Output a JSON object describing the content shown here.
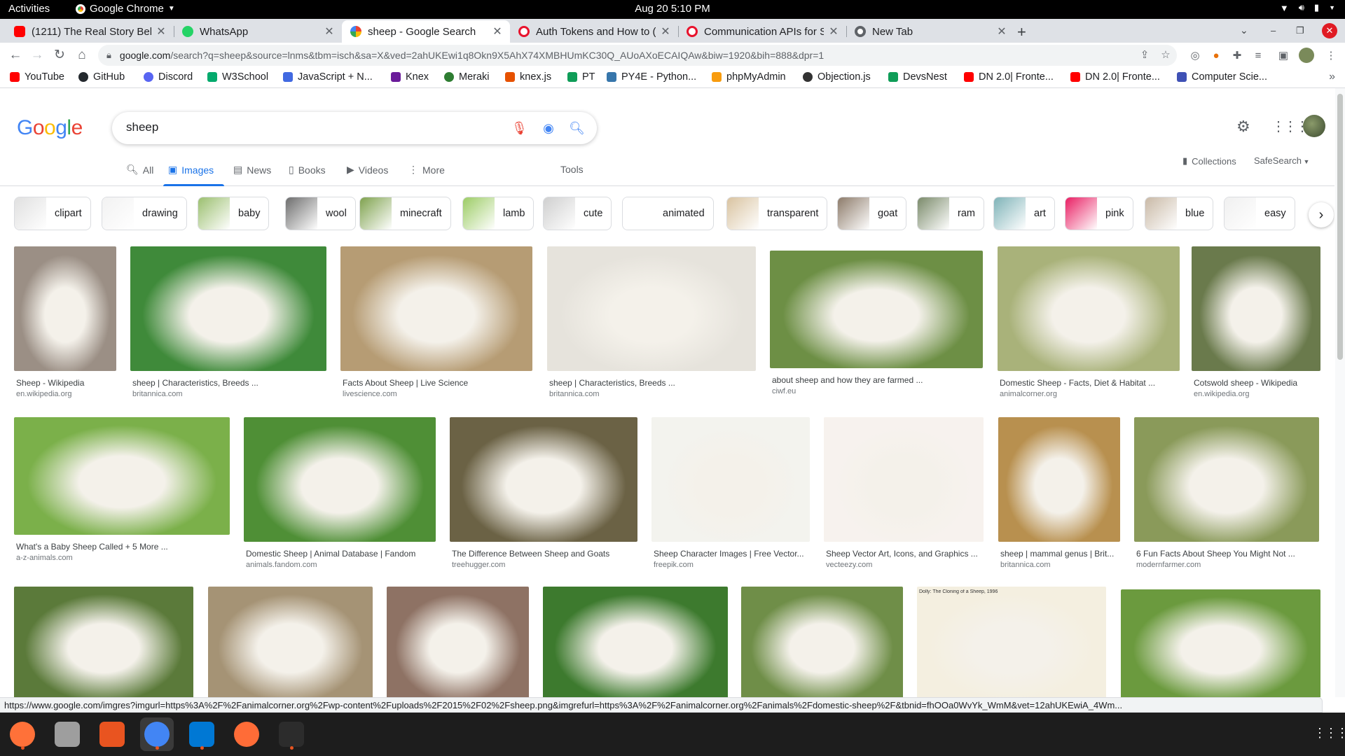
{
  "system": {
    "activities": "Activities",
    "app_name": "Google Chrome",
    "clock": "Aug 20  5:10 PM"
  },
  "tabs": [
    {
      "title": "(1211) The Real Story Behi",
      "favicon_color": "#ff0000",
      "favicon": "youtube-icon"
    },
    {
      "title": "WhatsApp",
      "favicon_color": "#25d366",
      "favicon": "whatsapp-icon"
    },
    {
      "title": "sheep - Google Search",
      "favicon_color": "#4285f4",
      "favicon": "google-icon"
    },
    {
      "title": "Auth Tokens and How to (",
      "favicon_color": "#e8132d",
      "favicon": "twilio-icon"
    },
    {
      "title": "Communication APIs for S",
      "favicon_color": "#e8132d",
      "favicon": "twilio-icon"
    },
    {
      "title": "New Tab",
      "favicon_color": "#5f6368",
      "favicon": "chrome-icon"
    }
  ],
  "toolbar": {
    "url_host": "google.com",
    "url_rest": "/search?q=sheep&source=lnms&tbm=isch&sa=X&ved=2ahUKEwi1q8Okn9X5AhX74XMBHUmKC30Q_AUoAXoECAIQAw&biw=1920&bih=888&dpr=1"
  },
  "bookmarks": [
    {
      "label": "YouTube",
      "color": "#ff0000"
    },
    {
      "label": "GitHub",
      "color": "#24292e"
    },
    {
      "label": "Discord",
      "color": "#5865f2"
    },
    {
      "label": "W3School",
      "color": "#04aa6d"
    },
    {
      "label": "JavaScript + N...",
      "color": "#4169e1"
    },
    {
      "label": "Knex",
      "color": "#6a1b9a"
    },
    {
      "label": "Meraki",
      "color": "#2e7d32"
    },
    {
      "label": "knex.js",
      "color": "#e65100"
    },
    {
      "label": "PT",
      "color": "#0f9d58"
    },
    {
      "label": "PY4E - Python...",
      "color": "#3776ab"
    },
    {
      "label": "phpMyAdmin",
      "color": "#f89c0e"
    },
    {
      "label": "Objection.js",
      "color": "#333333"
    },
    {
      "label": "DevsNest",
      "color": "#0f9d58"
    },
    {
      "label": "DN 2.0| Fronte...",
      "color": "#ff0000"
    },
    {
      "label": "DN 2.0| Fronte...",
      "color": "#ff0000"
    },
    {
      "label": "Computer Scie...",
      "color": "#3f51b5"
    }
  ],
  "search": {
    "query": "sheep"
  },
  "nav": {
    "all": "All",
    "images": "Images",
    "news": "News",
    "books": "Books",
    "videos": "Videos",
    "more": "More",
    "tools": "Tools",
    "collections": "Collections",
    "safesearch": "SafeSearch"
  },
  "chips": [
    {
      "label": "clipart",
      "color": "#e0e0e0"
    },
    {
      "label": "drawing",
      "color": "#f2f2f2"
    },
    {
      "label": "baby",
      "color": "#9bbf6f"
    },
    {
      "label": "wool",
      "color": "#6d6d6d"
    },
    {
      "label": "minecraft",
      "color": "#7fa24e"
    },
    {
      "label": "lamb",
      "color": "#9ccc65"
    },
    {
      "label": "cute",
      "color": "#cfcfcf"
    },
    {
      "label": "animated",
      "color": "#ffffff"
    },
    {
      "label": "transparent",
      "color": "#d9c3a0"
    },
    {
      "label": "goat",
      "color": "#8d7b6a"
    },
    {
      "label": "ram",
      "color": "#7a8a6a"
    },
    {
      "label": "art",
      "color": "#7fb3b8"
    },
    {
      "label": "pink",
      "color": "#e91e63"
    },
    {
      "label": "blue",
      "color": "#c9b9a6"
    },
    {
      "label": "easy",
      "color": "#f0f0f0"
    }
  ],
  "results": [
    {
      "caption": "Sheep - Wikipedia",
      "source": "en.wikipedia.org",
      "bg": "#9b8f85"
    },
    {
      "caption": "sheep | Characteristics, Breeds ...",
      "source": "britannica.com",
      "bg": "#3f8a3a"
    },
    {
      "caption": "Facts About Sheep | Live Science",
      "source": "livescience.com",
      "bg": "#b69c74"
    },
    {
      "caption": "sheep | Characteristics, Breeds ...",
      "source": "britannica.com",
      "bg": "#e6e3dc"
    },
    {
      "caption": "about sheep and how they are farmed ...",
      "source": "ciwf.eu",
      "bg": "#6d8f45"
    },
    {
      "caption": "Domestic Sheep - Facts, Diet & Habitat ...",
      "source": "animalcorner.org",
      "bg": "#a9b27a"
    },
    {
      "caption": "Cotswold sheep - Wikipedia",
      "source": "en.wikipedia.org",
      "bg": "#6a7a4c"
    },
    {
      "caption": "What's a Baby Sheep Called + 5 More ...",
      "source": "a-z-animals.com",
      "bg": "#7bb04a"
    },
    {
      "caption": "Domestic Sheep | Animal Database | Fandom",
      "source": "animals.fandom.com",
      "bg": "#4f8f36"
    },
    {
      "caption": "The Difference Between Sheep and Goats",
      "source": "treehugger.com",
      "bg": "#6b6245"
    },
    {
      "caption": "Sheep Character Images | Free Vector...",
      "source": "freepik.com",
      "bg": "#f3f3ee"
    },
    {
      "caption": "Sheep Vector Art, Icons, and Graphics ...",
      "source": "vecteezy.com",
      "bg": "#f7f2ee"
    },
    {
      "caption": "sheep | mammal genus | Brit...",
      "source": "britannica.com",
      "bg": "#b8904f"
    },
    {
      "caption": "6 Fun Facts About Sheep You Might Not ...",
      "source": "modernfarmer.com",
      "bg": "#8a9a5a"
    },
    {
      "caption": "",
      "source": "",
      "bg": "#5b7a3a"
    },
    {
      "caption": "",
      "source": "",
      "bg": "#a59375"
    },
    {
      "caption": "",
      "source": "",
      "bg": "#8e7264"
    },
    {
      "caption": "",
      "source": "",
      "bg": "#3d7a2e"
    },
    {
      "caption": "",
      "source": "",
      "bg": "#6f8e48"
    },
    {
      "caption": "Dolly: The Cloning of a Sheep, 1996",
      "source": "",
      "bg": "#f4efe0"
    },
    {
      "caption": "",
      "source": "",
      "bg": "#6b9a3e"
    }
  ],
  "status_url": "https://www.google.com/imgres?imgurl=https%3A%2F%2Fanimalcorner.org%2Fwp-content%2Fuploads%2F2015%2F02%2Fsheep.png&imgrefurl=https%3A%2F%2Fanimalcorner.org%2Fanimals%2Fdomestic-sheep%2F&tbnid=fhOOa0WvYk_WmM&vet=12ahUKEwiA_4Wm...",
  "dock": [
    {
      "name": "firefox-icon",
      "color": "#ff7139"
    },
    {
      "name": "files-icon",
      "color": "#9e9e9e"
    },
    {
      "name": "software-icon",
      "color": "#e95420"
    },
    {
      "name": "chrome-icon",
      "color": "#4285f4"
    },
    {
      "name": "vscode-icon",
      "color": "#0078d4"
    },
    {
      "name": "postman-icon",
      "color": "#ff6c37"
    },
    {
      "name": "terminal-icon",
      "color": "#2c2c2c"
    }
  ]
}
